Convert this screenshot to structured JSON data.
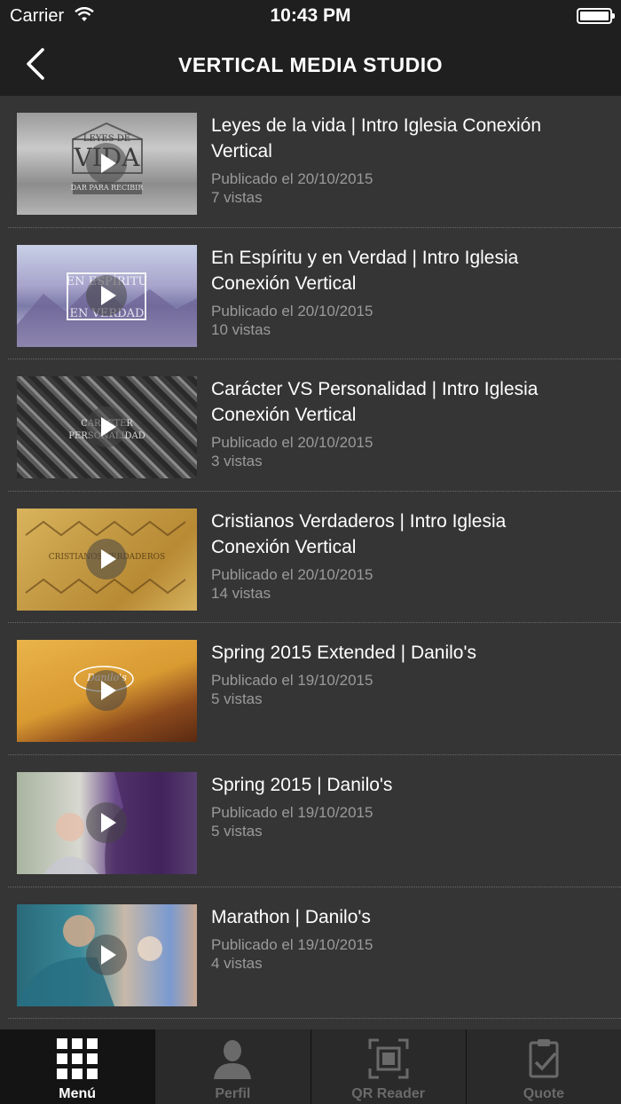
{
  "status": {
    "carrier": "Carrier",
    "time": "10:43 PM"
  },
  "nav": {
    "title": "VERTICAL MEDIA STUDIO"
  },
  "videos": [
    {
      "title": "Leyes de la vida  |  Intro Iglesia Conexión Vertical",
      "published": "Publicado el 20/10/2015",
      "views": "7 vistas",
      "thumb_text": "VIDA",
      "thumb_sub": "DAR PARA RECIBIR",
      "thumb_top": "LEYES DE"
    },
    {
      "title": "En Espíritu y en Verdad  |  Intro Iglesia Conexión Vertical",
      "published": "Publicado el 20/10/2015",
      "views": "10 vistas",
      "thumb_text": "EN ESPÍRITU",
      "thumb_sub": "EN VERDAD",
      "thumb_top": ""
    },
    {
      "title": "Carácter VS Personalidad  |  Intro Iglesia Conexión Vertical",
      "published": "Publicado el 20/10/2015",
      "views": "3 vistas",
      "thumb_text": "PERSONALIDAD",
      "thumb_sub": "",
      "thumb_top": "CARÁCTER"
    },
    {
      "title": "Cristianos Verdaderos  |  Intro Iglesia Conexión Vertical",
      "published": "Publicado el 20/10/2015",
      "views": "14 vistas",
      "thumb_text": "CRISTIANOS VERDADEROS",
      "thumb_sub": "",
      "thumb_top": ""
    },
    {
      "title": "Spring 2015 Extended  |  Danilo's",
      "published": "Publicado el 19/10/2015",
      "views": "5 vistas",
      "thumb_text": "Danilo's",
      "thumb_sub": "",
      "thumb_top": ""
    },
    {
      "title": "Spring 2015  |  Danilo's",
      "published": "Publicado el 19/10/2015",
      "views": "5 vistas",
      "thumb_text": "",
      "thumb_sub": "",
      "thumb_top": ""
    },
    {
      "title": "Marathon  |  Danilo's",
      "published": "Publicado el 19/10/2015",
      "views": "4 vistas",
      "thumb_text": "",
      "thumb_sub": "",
      "thumb_top": ""
    }
  ],
  "tabs": [
    {
      "label": "Menú",
      "icon": "grid-icon",
      "active": true
    },
    {
      "label": "Perfil",
      "icon": "person-icon",
      "active": false
    },
    {
      "label": "QR Reader",
      "icon": "qr-scan-icon",
      "active": false
    },
    {
      "label": "Quote",
      "icon": "clipboard-check-icon",
      "active": false
    }
  ],
  "colors": {
    "background": "#353535",
    "header": "#1f1f1f",
    "tabbar": "#2a2a2a",
    "meta_text": "#9a9a9a"
  }
}
